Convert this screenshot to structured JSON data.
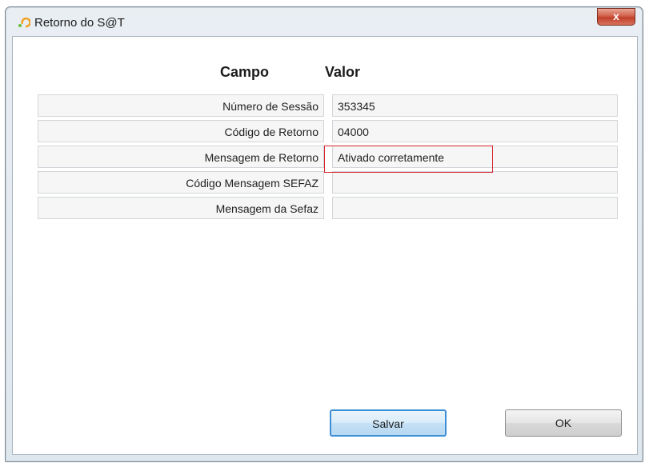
{
  "window": {
    "title": "Retorno do S@T",
    "close_label": "x"
  },
  "table": {
    "headers": {
      "field": "Campo",
      "value": "Valor"
    },
    "rows": [
      {
        "label": "Número de Sessão",
        "value": "353345"
      },
      {
        "label": "Código de Retorno",
        "value": "04000"
      },
      {
        "label": "Mensagem de Retorno",
        "value": "Ativado corretamente"
      },
      {
        "label": "Código Mensagem SEFAZ",
        "value": ""
      },
      {
        "label": "Mensagem da Sefaz",
        "value": ""
      }
    ]
  },
  "buttons": {
    "save": "Salvar",
    "ok": "OK"
  },
  "colors": {
    "highlight": "#d6252b",
    "focus": "#3d8fd6"
  }
}
